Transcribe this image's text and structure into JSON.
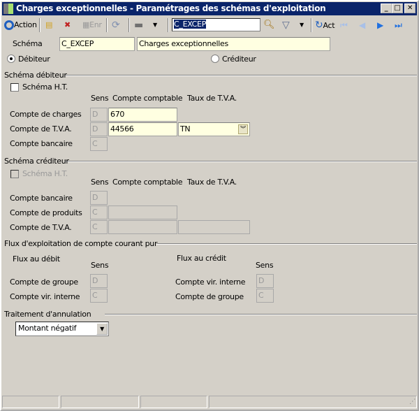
{
  "window": {
    "title": "Charges exceptionnelles -  Paramétrages des schémas d'exploitation",
    "min": "_",
    "max": "□",
    "close": "✕"
  },
  "toolbar": {
    "action": "Action",
    "save": "Enr",
    "search_value": "C_EXCEP",
    "act": "Act"
  },
  "header": {
    "schema_label": "Schéma",
    "schema_code": "C_EXCEP",
    "schema_desc": "Charges exceptionnelles",
    "debiteur": "Débiteur",
    "crediteur": "Créditeur",
    "selected": "debiteur"
  },
  "debit": {
    "title": "Schéma débiteur",
    "ht": "Schéma H.T.",
    "col_sens": "Sens",
    "col_compte": "Compte comptable",
    "col_tva": "Taux de T.V.A.",
    "rows": [
      {
        "label": "Compte de charges",
        "sens": "D",
        "compte": "670"
      },
      {
        "label": "Compte de T.V.A.",
        "sens": "D",
        "compte": "44566",
        "tva": "TN"
      },
      {
        "label": "Compte bancaire",
        "sens": "C"
      }
    ]
  },
  "credit": {
    "title": "Schéma créditeur",
    "ht": "Schéma H.T.",
    "col_sens": "Sens",
    "col_compte": "Compte comptable",
    "col_tva": "Taux de T.V.A.",
    "rows": [
      {
        "label": "Compte bancaire",
        "sens": "D"
      },
      {
        "label": "Compte de produits",
        "sens": "C",
        "compte": ""
      },
      {
        "label": "Compte de T.V.A.",
        "sens": "C",
        "compte": "",
        "tva": ""
      }
    ]
  },
  "flux": {
    "title": "Flux d'exploitation de compte courant pur",
    "debit_title": "Flux au débit",
    "credit_title": "Flux au crédit",
    "sens": "Sens",
    "debit_rows": [
      {
        "label": "Compte de groupe",
        "sens": "D"
      },
      {
        "label": "Compte vir. interne",
        "sens": "C"
      }
    ],
    "credit_rows": [
      {
        "label": "Compte vir. interne",
        "sens": "D"
      },
      {
        "label": "Compte de groupe",
        "sens": "C"
      }
    ]
  },
  "annulation": {
    "title": "Traitement d'annulation",
    "value": "Montant négatif"
  }
}
